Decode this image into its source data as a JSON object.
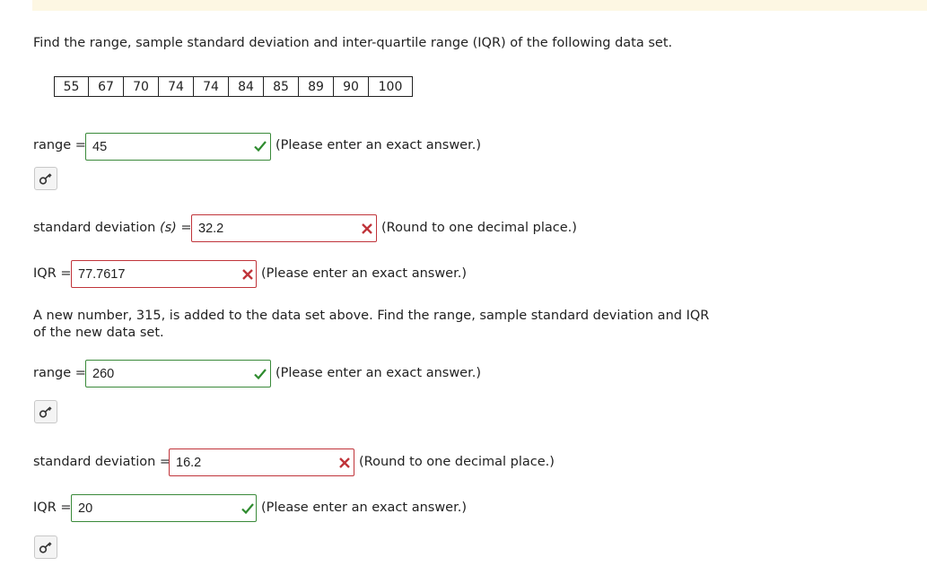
{
  "question": {
    "prompt": "Find the range, sample standard deviation and inter-quartile range (IQR) of the following data set.",
    "data_values": [
      "55",
      "67",
      "70",
      "74",
      "74",
      "84",
      "85",
      "89",
      "90",
      "100"
    ]
  },
  "part1": {
    "range": {
      "label": "range =",
      "value": "45",
      "note": "(Please enter an exact answer.)",
      "status": "correct"
    },
    "sd": {
      "label": "standard deviation",
      "symbol": "(s)",
      "eq": "=",
      "value": "32.2",
      "note": "(Round to one decimal place.)",
      "status": "incorrect"
    },
    "iqr": {
      "label": "IQR =",
      "value": "77.7617",
      "note": "(Please enter an exact answer.)",
      "status": "incorrect"
    }
  },
  "part2": {
    "prompt": "A new number, 315, is added to the data set above. Find the range, sample standard deviation and IQR of the new data set.",
    "range": {
      "label": "range =",
      "value": "260",
      "note": "(Please enter an exact answer.)",
      "status": "correct"
    },
    "sd": {
      "label": "standard deviation =",
      "value": "16.2",
      "note": "(Round to one decimal place.)",
      "status": "incorrect"
    },
    "iqr": {
      "label": "IQR =",
      "value": "20",
      "note": "(Please enter an exact answer.)",
      "status": "correct"
    }
  },
  "colors": {
    "correct": "#2e8b2e",
    "incorrect": "#c0343a",
    "banner": "#fdf7e3"
  },
  "icons": {
    "correct": "check-icon",
    "incorrect": "x-icon",
    "answer_key": "key-icon"
  }
}
